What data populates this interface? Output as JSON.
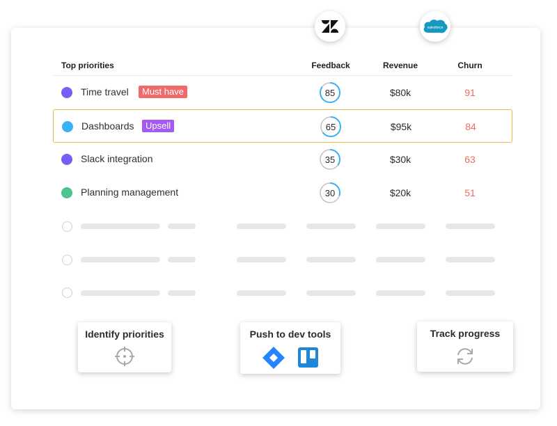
{
  "integrations": {
    "zendesk": "zendesk-icon",
    "salesforce": "salesforce"
  },
  "table": {
    "headers": {
      "priorities": "Top priorities",
      "feedback": "Feedback",
      "revenue": "Revenue",
      "churn": "Churn"
    },
    "rows": [
      {
        "name": "Time travel",
        "tag": "Must have",
        "tag_color": "#ef6b6b",
        "dot_color": "#7b5cf5",
        "feedback": "85",
        "feedback_level": 0.85,
        "revenue": "$80k",
        "churn": "91"
      },
      {
        "name": "Dashboards",
        "tag": "Upsell",
        "tag_color": "#a45af0",
        "dot_color": "#3ab0f5",
        "feedback": "65",
        "feedback_level": 0.65,
        "revenue": "$95k",
        "churn": "84"
      },
      {
        "name": "Slack integration",
        "tag": "",
        "tag_color": "",
        "dot_color": "#7b5cf5",
        "feedback": "35",
        "feedback_level": 0.35,
        "revenue": "$30k",
        "churn": "63"
      },
      {
        "name": "Planning management",
        "tag": "",
        "tag_color": "",
        "dot_color": "#4fc58c",
        "feedback": "30",
        "feedback_level": 0.3,
        "revenue": "$20k",
        "churn": "51"
      }
    ]
  },
  "steps": {
    "identify": "Identify priorities",
    "push": "Push to dev tools",
    "track": "Track progress"
  },
  "colors": {
    "accent": "#f3b640",
    "ring": "#3ab0f5",
    "churn": "#ee6b63"
  }
}
